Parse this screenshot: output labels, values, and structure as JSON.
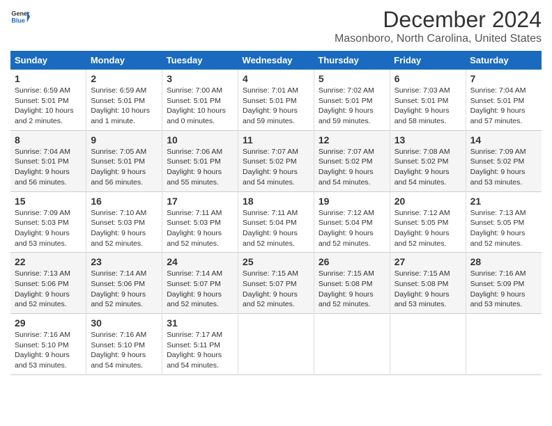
{
  "logo": {
    "line1": "General",
    "line2": "Blue"
  },
  "title": "December 2024",
  "location": "Masonboro, North Carolina, United States",
  "days_of_week": [
    "Sunday",
    "Monday",
    "Tuesday",
    "Wednesday",
    "Thursday",
    "Friday",
    "Saturday"
  ],
  "weeks": [
    [
      {
        "day": "1",
        "sunrise": "6:59 AM",
        "sunset": "5:01 PM",
        "daylight": "10 hours and 2 minutes."
      },
      {
        "day": "2",
        "sunrise": "6:59 AM",
        "sunset": "5:01 PM",
        "daylight": "10 hours and 1 minute."
      },
      {
        "day": "3",
        "sunrise": "7:00 AM",
        "sunset": "5:01 PM",
        "daylight": "10 hours and 0 minutes."
      },
      {
        "day": "4",
        "sunrise": "7:01 AM",
        "sunset": "5:01 PM",
        "daylight": "9 hours and 59 minutes."
      },
      {
        "day": "5",
        "sunrise": "7:02 AM",
        "sunset": "5:01 PM",
        "daylight": "9 hours and 59 minutes."
      },
      {
        "day": "6",
        "sunrise": "7:03 AM",
        "sunset": "5:01 PM",
        "daylight": "9 hours and 58 minutes."
      },
      {
        "day": "7",
        "sunrise": "7:04 AM",
        "sunset": "5:01 PM",
        "daylight": "9 hours and 57 minutes."
      }
    ],
    [
      {
        "day": "8",
        "sunrise": "7:04 AM",
        "sunset": "5:01 PM",
        "daylight": "9 hours and 56 minutes."
      },
      {
        "day": "9",
        "sunrise": "7:05 AM",
        "sunset": "5:01 PM",
        "daylight": "9 hours and 56 minutes."
      },
      {
        "day": "10",
        "sunrise": "7:06 AM",
        "sunset": "5:01 PM",
        "daylight": "9 hours and 55 minutes."
      },
      {
        "day": "11",
        "sunrise": "7:07 AM",
        "sunset": "5:02 PM",
        "daylight": "9 hours and 54 minutes."
      },
      {
        "day": "12",
        "sunrise": "7:07 AM",
        "sunset": "5:02 PM",
        "daylight": "9 hours and 54 minutes."
      },
      {
        "day": "13",
        "sunrise": "7:08 AM",
        "sunset": "5:02 PM",
        "daylight": "9 hours and 54 minutes."
      },
      {
        "day": "14",
        "sunrise": "7:09 AM",
        "sunset": "5:02 PM",
        "daylight": "9 hours and 53 minutes."
      }
    ],
    [
      {
        "day": "15",
        "sunrise": "7:09 AM",
        "sunset": "5:03 PM",
        "daylight": "9 hours and 53 minutes."
      },
      {
        "day": "16",
        "sunrise": "7:10 AM",
        "sunset": "5:03 PM",
        "daylight": "9 hours and 52 minutes."
      },
      {
        "day": "17",
        "sunrise": "7:11 AM",
        "sunset": "5:03 PM",
        "daylight": "9 hours and 52 minutes."
      },
      {
        "day": "18",
        "sunrise": "7:11 AM",
        "sunset": "5:04 PM",
        "daylight": "9 hours and 52 minutes."
      },
      {
        "day": "19",
        "sunrise": "7:12 AM",
        "sunset": "5:04 PM",
        "daylight": "9 hours and 52 minutes."
      },
      {
        "day": "20",
        "sunrise": "7:12 AM",
        "sunset": "5:05 PM",
        "daylight": "9 hours and 52 minutes."
      },
      {
        "day": "21",
        "sunrise": "7:13 AM",
        "sunset": "5:05 PM",
        "daylight": "9 hours and 52 minutes."
      }
    ],
    [
      {
        "day": "22",
        "sunrise": "7:13 AM",
        "sunset": "5:06 PM",
        "daylight": "9 hours and 52 minutes."
      },
      {
        "day": "23",
        "sunrise": "7:14 AM",
        "sunset": "5:06 PM",
        "daylight": "9 hours and 52 minutes."
      },
      {
        "day": "24",
        "sunrise": "7:14 AM",
        "sunset": "5:07 PM",
        "daylight": "9 hours and 52 minutes."
      },
      {
        "day": "25",
        "sunrise": "7:15 AM",
        "sunset": "5:07 PM",
        "daylight": "9 hours and 52 minutes."
      },
      {
        "day": "26",
        "sunrise": "7:15 AM",
        "sunset": "5:08 PM",
        "daylight": "9 hours and 52 minutes."
      },
      {
        "day": "27",
        "sunrise": "7:15 AM",
        "sunset": "5:08 PM",
        "daylight": "9 hours and 53 minutes."
      },
      {
        "day": "28",
        "sunrise": "7:16 AM",
        "sunset": "5:09 PM",
        "daylight": "9 hours and 53 minutes."
      }
    ],
    [
      {
        "day": "29",
        "sunrise": "7:16 AM",
        "sunset": "5:10 PM",
        "daylight": "9 hours and 53 minutes."
      },
      {
        "day": "30",
        "sunrise": "7:16 AM",
        "sunset": "5:10 PM",
        "daylight": "9 hours and 54 minutes."
      },
      {
        "day": "31",
        "sunrise": "7:17 AM",
        "sunset": "5:11 PM",
        "daylight": "9 hours and 54 minutes."
      },
      null,
      null,
      null,
      null
    ]
  ]
}
